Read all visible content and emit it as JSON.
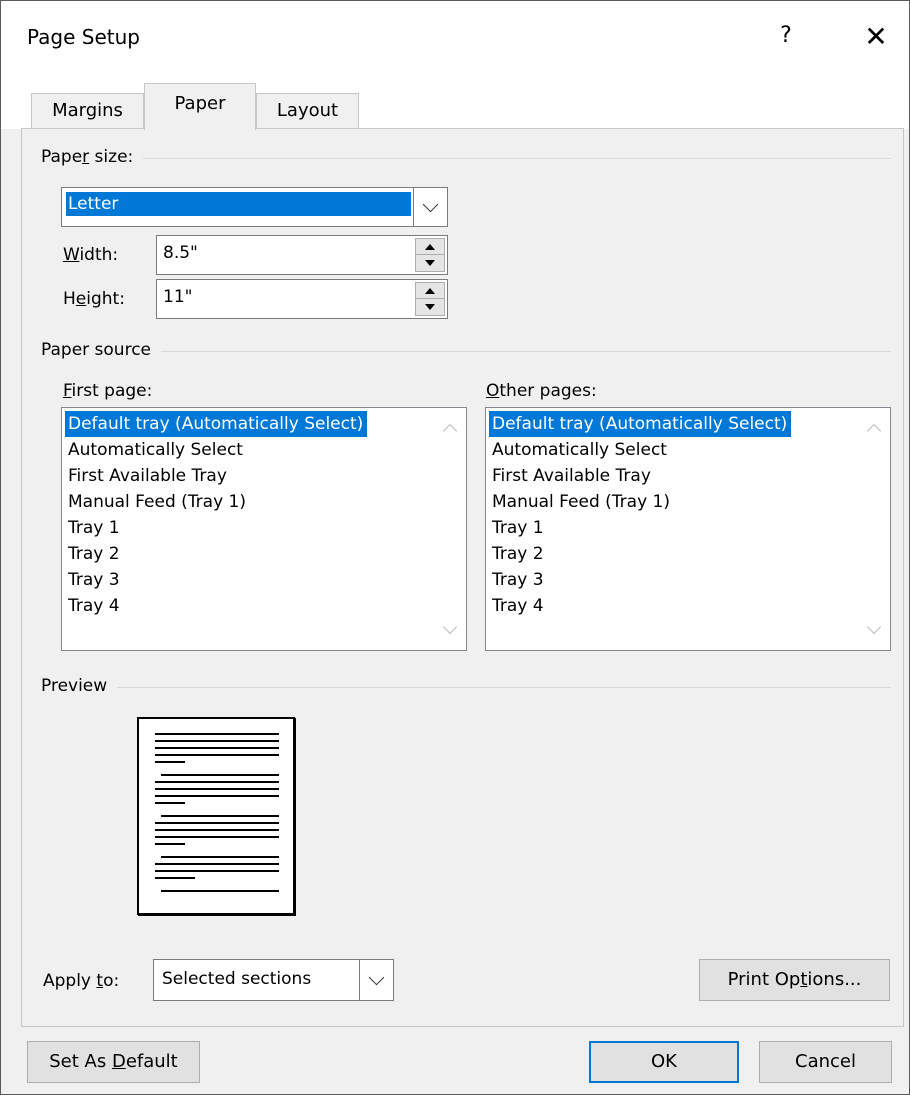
{
  "window": {
    "title": "Page Setup",
    "help": "?",
    "close": "✕"
  },
  "tabs": [
    {
      "label": "Margins"
    },
    {
      "label": "Paper"
    },
    {
      "label": "Layout"
    }
  ],
  "paper_size": {
    "group_label_pre": "Pape",
    "group_label_acc": "r",
    "group_label_post": " size:",
    "selected": "Letter",
    "width": {
      "label_acc": "W",
      "label_post": "idth:",
      "value": "8.5\""
    },
    "height": {
      "label_pre": "H",
      "label_acc": "e",
      "label_post": "ight:",
      "value": "11\""
    }
  },
  "paper_source": {
    "group_label": "Paper source",
    "first_page": {
      "label_acc": "F",
      "label_post": "irst page:",
      "items": [
        "Default tray (Automatically Select)",
        "Automatically Select",
        "First Available Tray",
        "Manual Feed (Tray 1)",
        "Tray 1",
        "Tray 2",
        "Tray 3",
        "Tray 4"
      ],
      "selected_index": 0
    },
    "other_pages": {
      "label_acc": "O",
      "label_post": "ther pages:",
      "items": [
        "Default tray (Automatically Select)",
        "Automatically Select",
        "First Available Tray",
        "Manual Feed (Tray 1)",
        "Tray 1",
        "Tray 2",
        "Tray 3",
        "Tray 4"
      ],
      "selected_index": 0
    }
  },
  "preview": {
    "group_label": "Preview"
  },
  "apply_to": {
    "label_pre": "Apply ",
    "label_acc": "t",
    "label_post": "o:",
    "value": "Selected sections"
  },
  "buttons": {
    "print_options": {
      "pre": "Print Op",
      "acc": "t",
      "post": "ions..."
    },
    "set_as_default": {
      "pre": "Set As ",
      "acc": "D",
      "post": "efault"
    },
    "ok": "OK",
    "cancel": "Cancel"
  },
  "colors": {
    "selection": "#0078d7",
    "dialog_bg": "#f0f0f0"
  }
}
